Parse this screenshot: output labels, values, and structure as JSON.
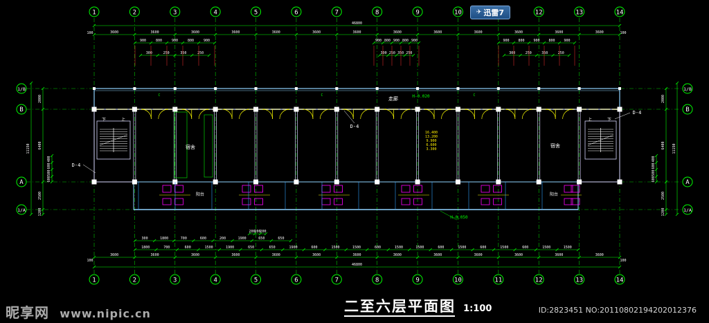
{
  "badge": {
    "icon": "xunlei-bird-icon",
    "label": "迅雷7"
  },
  "title": {
    "text": "二至六层平面图",
    "scale": "1:100"
  },
  "watermark": {
    "logo": "昵享网",
    "url": "www.nipic.cn"
  },
  "photo_id": "ID:2823451 NO:20110802194202012376",
  "axes": {
    "columns": [
      "1",
      "2",
      "3",
      "4",
      "5",
      "6",
      "7",
      "8",
      "9",
      "10",
      "11",
      "12",
      "13",
      "14"
    ],
    "rows": [
      "1/B",
      "B",
      "A",
      "1/A"
    ]
  },
  "dimensions": {
    "overall": "46800",
    "edge": "100",
    "top_bays": [
      "3600",
      "3600",
      "3600",
      "3600",
      "3600",
      "3600",
      "3600",
      "3600",
      "3600",
      "3600",
      "3600",
      "3600",
      "3600"
    ],
    "bottom_bays": [
      "3600",
      "3600",
      "3600",
      "3600",
      "3600",
      "3600",
      "3600",
      "3600",
      "3600",
      "3600",
      "3600",
      "3600",
      "3600"
    ],
    "window_sub_top": [
      "900",
      "800",
      "900",
      "800",
      "900"
    ],
    "window_small_top": [
      "300",
      "250",
      "350",
      "250"
    ],
    "lower_sub": [
      "1800",
      "700",
      "600",
      "1500",
      "1900",
      "650",
      "650",
      "1900",
      "600",
      "1500",
      "1500",
      "600",
      "1500",
      "1500",
      "600",
      "1500",
      "600",
      "1500",
      "600",
      "1500",
      "1500"
    ],
    "side_left": [
      "2000",
      "6400",
      "11150",
      "400",
      "600",
      "500",
      "600",
      "2500",
      "1200"
    ],
    "side_right": [
      "2000",
      "6400",
      "11150",
      "2500",
      "1200"
    ]
  },
  "labels": {
    "corridor": "走廊",
    "dorm_left": "宿舍",
    "dorm_right": "宿舍",
    "balcony_left": "阳台",
    "balcony_right": "阳台",
    "door_tag": "D-4",
    "elev_corridor": "H-0.020",
    "elev_balcony": "H-0.050",
    "stair_down": "下",
    "stair_up": "上",
    "floor_levels": [
      "16.400",
      "13.200",
      "9.900",
      "6.600",
      "3.300"
    ]
  },
  "colors": {
    "axis": "#00c800",
    "dim": "#00ff00",
    "wall": "#8fd3ff",
    "wall_inner": "#d8d8ff",
    "column": "#ffffff",
    "door": "#ffff00",
    "fixture": "#ff00ff",
    "text": "#ffffff"
  }
}
